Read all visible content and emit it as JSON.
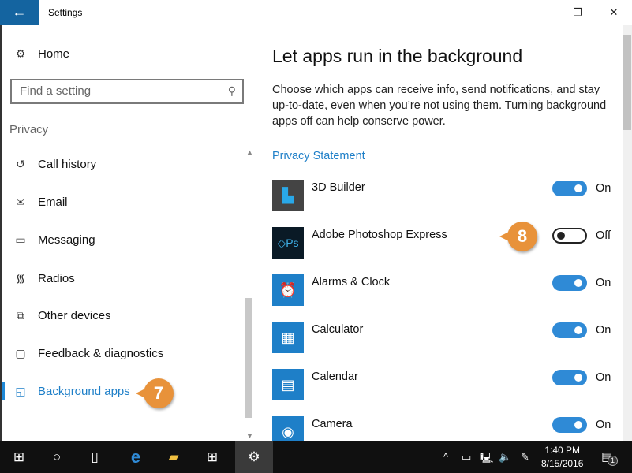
{
  "window": {
    "title": "Settings",
    "back_icon": "arrow-left-icon",
    "minimize_icon": "minimize-icon",
    "maximize_icon": "restore-icon",
    "close_icon": "close-icon"
  },
  "sidebar": {
    "home": "Home",
    "search_placeholder": "Find a setting",
    "section": "Privacy",
    "items": [
      {
        "label": "Call history",
        "icon": "history-icon"
      },
      {
        "label": "Email",
        "icon": "mail-icon"
      },
      {
        "label": "Messaging",
        "icon": "chat-icon"
      },
      {
        "label": "Radios",
        "icon": "radio-tower-icon"
      },
      {
        "label": "Other devices",
        "icon": "devices-icon"
      },
      {
        "label": "Feedback & diagnostics",
        "icon": "feedback-icon"
      },
      {
        "label": "Background apps",
        "icon": "background-apps-icon",
        "selected": true
      }
    ],
    "callout": "7"
  },
  "main": {
    "heading": "Let apps run in the background",
    "description": "Choose which apps can receive info, send notifications, and stay up-to-date, even when you’re not using them. Turning background apps off can help conserve power.",
    "privacy_link": "Privacy Statement",
    "callout": "8",
    "apps": [
      {
        "name": "3D Builder",
        "on": true,
        "state": "On",
        "color": "#444444"
      },
      {
        "name": "Adobe Photoshop Express",
        "on": false,
        "state": "Off",
        "color": "#0a1a26"
      },
      {
        "name": "Alarms & Clock",
        "on": true,
        "state": "On",
        "color": "#1e7fc8"
      },
      {
        "name": "Calculator",
        "on": true,
        "state": "On",
        "color": "#1e7fc8"
      },
      {
        "name": "Calendar",
        "on": true,
        "state": "On",
        "color": "#1e7fc8"
      },
      {
        "name": "Camera",
        "on": true,
        "state": "On",
        "color": "#1e7fc8"
      }
    ]
  },
  "taskbar": {
    "time": "1:40 PM",
    "date": "8/15/2016",
    "notifications": "1"
  },
  "accent": "#1e88d6"
}
